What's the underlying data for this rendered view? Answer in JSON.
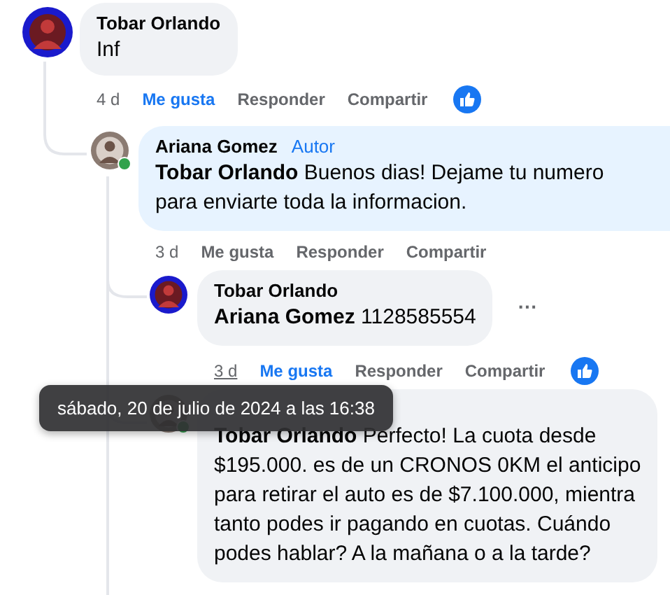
{
  "comments": [
    {
      "author": "Tobar Orlando",
      "text": "Inf",
      "time": "4 d",
      "time_hovered": false,
      "liked": true,
      "reaction": true,
      "actions": [
        "Me gusta",
        "Responder",
        "Compartir"
      ],
      "replies": [
        {
          "author": "Ariana Gomez",
          "badge": "Autor",
          "text": "**Tobar Orlando** Buenos dias! Dejame tu numero\npara enviarte toda la informacion.",
          "time": "3 d",
          "time_hovered": false,
          "online": true,
          "liked": false,
          "actions": [
            "Me gusta",
            "Responder",
            "Compartir"
          ],
          "replies": [
            {
              "author": "Tobar Orlando",
              "text": "**Ariana Gomez** 1128585554",
              "time": "3 d",
              "time_hovered": true,
              "liked": true,
              "reaction": true,
              "more": "···",
              "actions": [
                "Me gusta",
                "Responder",
                "Compartir"
              ]
            },
            {
              "text": "**Tobar Orlando** Perfecto! La cuota desde\n$195.000. es de un CRONOS 0KM el anticipo\npara retirar el auto es de $7.100.000, mientra\ntanto podes ir pagando en cuotas. Cuándo\npodes hablar? A la mañana o a la tarde?",
              "online": true
            }
          ]
        }
      ]
    }
  ],
  "tooltip": "sábado, 20 de julio de 2024 a las 16:38"
}
